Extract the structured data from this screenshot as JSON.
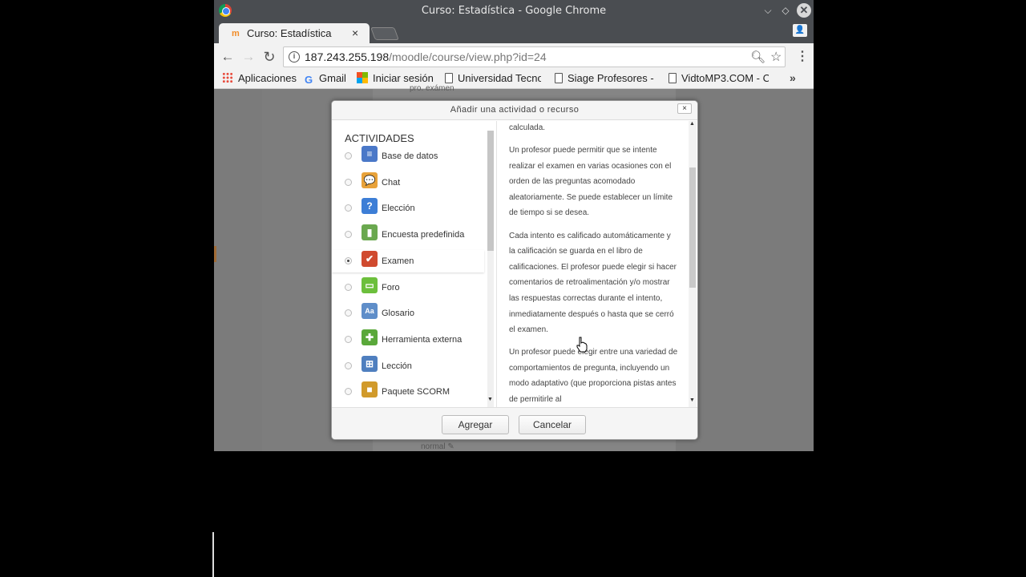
{
  "window": {
    "title": "Curso: Estadística - Google Chrome"
  },
  "tab": {
    "title": "Curso: Estadística",
    "close": "×"
  },
  "address": {
    "host": "187.243.255.198",
    "path": "/moodle/course/view.php?id=24"
  },
  "bookmarks": [
    {
      "label": "Aplicaciones",
      "icon": "apps-icon"
    },
    {
      "label": "Gmail",
      "icon": "google-icon"
    },
    {
      "label": "Iniciar sesión",
      "icon": "windows-icon"
    },
    {
      "label": "Universidad Tecno",
      "icon": "page-icon"
    },
    {
      "label": "Siage Profesores -",
      "icon": "page-icon"
    },
    {
      "label": "VidtoMP3.COM - C",
      "icon": "page-icon"
    }
  ],
  "modal": {
    "title": "Añadir una actividad o recurso",
    "close": "×",
    "heading": "ACTIVIDADES",
    "options": [
      {
        "label": "Base de datos",
        "icon": "database-icon",
        "color": "#4a78c8",
        "selected": false
      },
      {
        "label": "Chat",
        "icon": "chat-icon",
        "color": "#e8a23a",
        "selected": false
      },
      {
        "label": "Elección",
        "icon": "question-icon",
        "color": "#3d7ed6",
        "selected": false
      },
      {
        "label": "Encuesta predefinida",
        "icon": "chart-icon",
        "color": "#6aa84f",
        "selected": false
      },
      {
        "label": "Examen",
        "icon": "quiz-check-icon",
        "color": "#d04a2f",
        "selected": true
      },
      {
        "label": "Foro",
        "icon": "forum-icon",
        "color": "#6cbf3c",
        "selected": false
      },
      {
        "label": "Glosario",
        "icon": "glossary-icon",
        "color": "#5f8ec9",
        "selected": false
      },
      {
        "label": "Herramienta externa",
        "icon": "puzzle-icon",
        "color": "#5aa83a",
        "selected": false
      },
      {
        "label": "Lección",
        "icon": "lesson-icon",
        "color": "#4f7fbf",
        "selected": false
      },
      {
        "label": "Paquete SCORM",
        "icon": "package-icon",
        "color": "#d19a2a",
        "selected": false
      }
    ],
    "description": [
      "calculada.",
      "Un profesor puede permitir que se intente realizar el examen en varias ocasiones con el orden de las preguntas acomodado aleatoriamente. Se puede establecer un límite de tiempo si se desea.",
      "Cada intento es calificado automáticamente y la calificación se guarda en el libro de calificaciones. El profesor puede elegir si hacer comentarios de retroalimentación y/o mostrar las respuestas correctas durante el intento, inmediatamente después o hasta que se cerró el examen.",
      "Un profesor puede elegir entre una variedad de comportamientos de pregunta, incluyendo un modo adaptativo (que proporciona pistas antes de permitirle al"
    ],
    "add_label": "Agregar",
    "cancel_label": "Cancelar"
  },
  "page": {
    "bottom_text": "normal ✎",
    "top_text": "pro. exámen"
  }
}
